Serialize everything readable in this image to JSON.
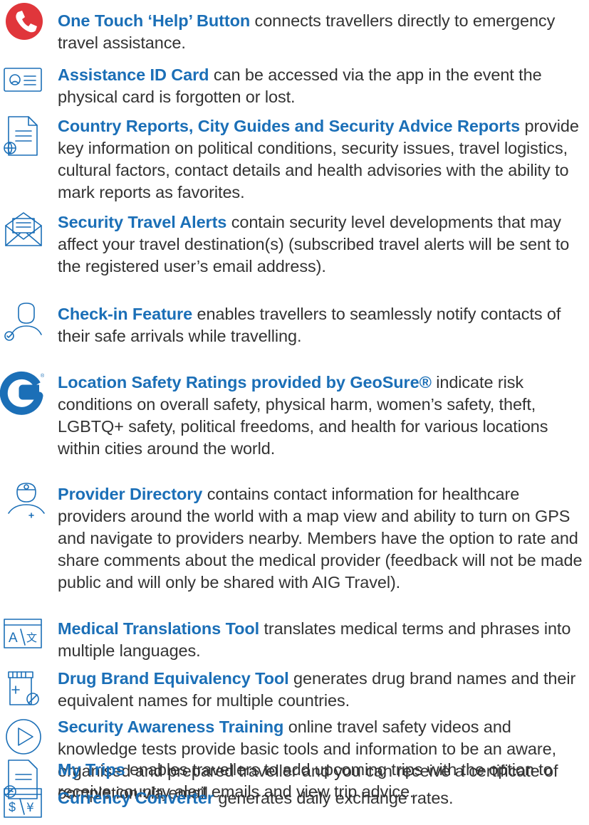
{
  "accent_color": "#1b6fb7",
  "text_color": "#333333",
  "danger_color": "#e0363b",
  "features": [
    {
      "icon": "phone-icon",
      "title": "One Touch ‘Help’ Button",
      "description": " connects travellers directly to emergency travel assistance."
    },
    {
      "icon": "id-card-icon",
      "title": "Assistance ID Card",
      "description": " can be accessed via the app in the event the physical card is forgotten or lost."
    },
    {
      "icon": "globe-document-icon",
      "title": "Country Reports, City Guides and Security Advice Reports",
      "description": " provide key information on political conditions, security issues, travel logistics, cultural factors, contact details and health advisories with the ability to mark reports as favorites."
    },
    {
      "icon": "envelope-icon",
      "title": "Security Travel Alerts",
      "description": " contain security level developments that may affect your travel destination(s) (subscribed travel alerts will be sent to the registered user’s email address)."
    },
    {
      "icon": "person-check-icon",
      "title": "Check-in Feature",
      "description": " enables travellers to seamlessly notify contacts of their safe arrivals while travelling."
    },
    {
      "icon": "geosure-logo-icon",
      "title": "Location Safety Ratings provided by GeoSure®",
      "description": " indicate risk conditions on overall safety, physical harm, women’s safety, theft, LGBTQ+ safety, political freedoms, and health for various locations within cities around the world."
    },
    {
      "icon": "doctor-icon",
      "title": "Provider Directory",
      "description": " contains contact information for healthcare providers around the world with a map view and ability to turn on GPS and navigate to providers nearby. Members have the option to rate and share comments about the medical provider (feedback will not be made public and will only be shared with AIG Travel)."
    },
    {
      "icon": "translate-icon",
      "title": "Medical Translations Tool",
      "description": " translates medical terms and phrases into multiple languages."
    },
    {
      "icon": "pill-bottle-icon",
      "title": "Drug Brand Equivalency Tool",
      "description": " generates drug brand names and their equivalent names for multiple countries."
    },
    {
      "icon": "play-icon",
      "title": "Security Awareness Training",
      "description": " online travel safety videos and knowledge tests provide basic tools and information to be an aware, organised and prepared traveller and you can receive a certificate of completion via email."
    },
    {
      "icon": "trip-document-icon",
      "title": "My Trips",
      "description": " enables travellers to add upcoming trips with the option to receive country alert emails and view trip advice."
    },
    {
      "icon": "currency-icon",
      "title": "Currency Converter",
      "description": " generates daily exchange rates."
    }
  ]
}
